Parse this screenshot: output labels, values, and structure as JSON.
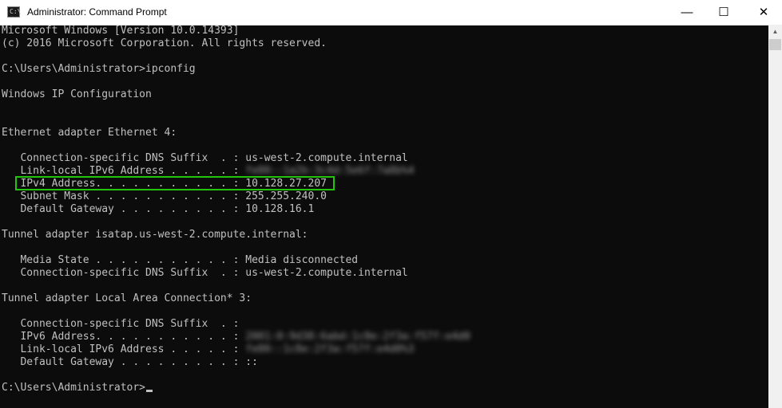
{
  "window": {
    "title": "Administrator: Command Prompt",
    "icon_label": "C:\\",
    "controls": {
      "minimize": "—",
      "maximize": "☐",
      "close": "✕"
    }
  },
  "console": {
    "lines": [
      "Microsoft Windows [Version 10.0.14393]",
      "(c) 2016 Microsoft Corporation. All rights reserved.",
      "",
      "C:\\Users\\Administrator>ipconfig",
      "",
      "Windows IP Configuration",
      "",
      "",
      "Ethernet adapter Ethernet 4:",
      "",
      "   Connection-specific DNS Suffix  . : us-west-2.compute.internal",
      "   Link-local IPv6 Address . . . . . : ",
      "   IPv4 Address. . . . . . . . . . . : 10.128.27.207",
      "   Subnet Mask . . . . . . . . . . . : 255.255.240.0",
      "   Default Gateway . . . . . . . . . : 10.128.16.1",
      "",
      "Tunnel adapter isatap.us-west-2.compute.internal:",
      "",
      "   Media State . . . . . . . . . . . : Media disconnected",
      "   Connection-specific DNS Suffix  . : us-west-2.compute.internal",
      "",
      "Tunnel adapter Local Area Connection* 3:",
      "",
      "   Connection-specific DNS Suffix  . :",
      "   IPv6 Address. . . . . . . . . . . : ",
      "   Link-local IPv6 Address . . . . . : ",
      "   Default Gateway . . . . . . . . . : ::",
      "",
      "C:\\Users\\Administrator>"
    ],
    "blurred_values": {
      "11": "fe80::1a2b:3c4d:5e6f:7a8b%4",
      "24": "2001:0:9d38:6abd:1c8e:2f3a:f57f:e4d0",
      "25": "fe80::1c8e:2f3a:f57f:e4d0%3"
    },
    "highlight_color": "#22c40c",
    "text_color": "#c0c0c0",
    "background": "#0c0c0c"
  }
}
